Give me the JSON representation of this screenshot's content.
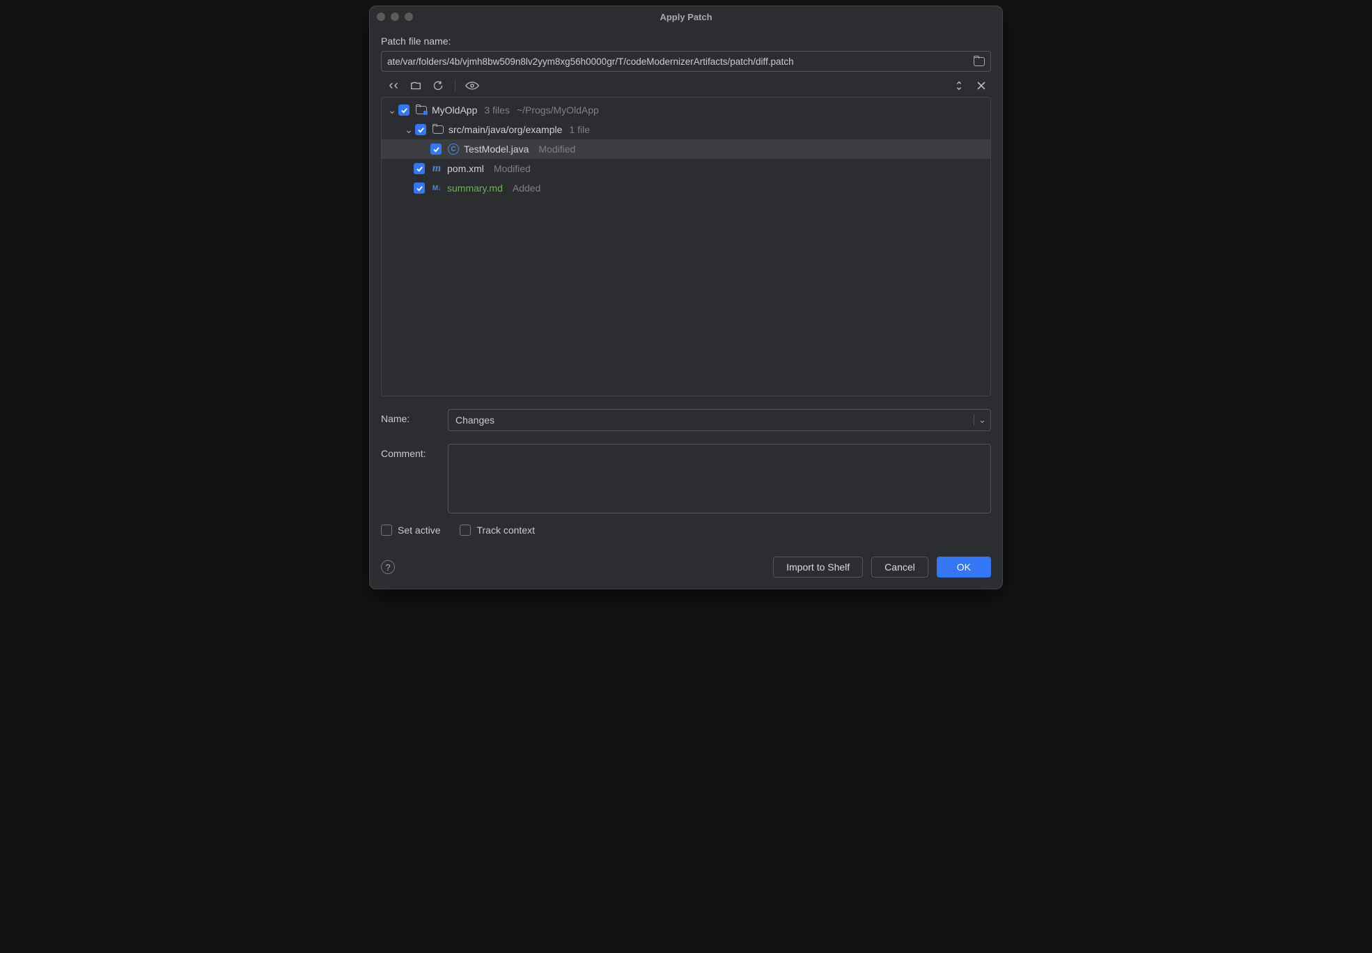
{
  "title": "Apply Patch",
  "patchFile": {
    "label": "Patch file name:",
    "value": "ate/var/folders/4b/vjmh8bw509n8lv2yym8xg56h0000gr/T/codeModernizerArtifacts/patch/diff.patch"
  },
  "tree": {
    "root": {
      "name": "MyOldApp",
      "count": "3 files",
      "path": "~/Progs/MyOldApp"
    },
    "pkg": {
      "name": "src/main/java/org/example",
      "count": "1 file"
    },
    "file1": {
      "name": "TestModel.java",
      "status": "Modified"
    },
    "file2": {
      "name": "pom.xml",
      "status": "Modified"
    },
    "file3": {
      "name": "summary.md",
      "status": "Added"
    }
  },
  "nameField": {
    "label": "Name:",
    "value": "Changes"
  },
  "commentField": {
    "label": "Comment:",
    "value": ""
  },
  "setActive": {
    "label": "Set active",
    "checked": false
  },
  "trackContext": {
    "label": "Track context",
    "checked": false
  },
  "buttons": {
    "importShelf": "Import to Shelf",
    "cancel": "Cancel",
    "ok": "OK"
  }
}
